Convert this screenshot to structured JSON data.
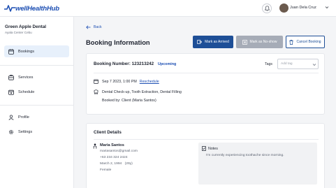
{
  "brand": {
    "logo_text": "wellHealthHub"
  },
  "header": {
    "user_name": "Juan Dela Cruz"
  },
  "sidebar": {
    "clinic_name": "Green Apple Dental",
    "clinic_location": "Ayala Center Cebu",
    "items": [
      {
        "label": "Bookings",
        "icon": "calendar-icon",
        "active": true
      },
      {
        "label": "Services",
        "icon": "services-icon",
        "active": false
      },
      {
        "label": "Schedule",
        "icon": "schedule-icon",
        "active": false
      },
      {
        "label": "Profile",
        "icon": "user-icon",
        "active": false
      },
      {
        "label": "Settings",
        "icon": "gear-icon",
        "active": false
      }
    ]
  },
  "page": {
    "back_label": "Back",
    "title": "Booking Information",
    "actions": {
      "mark_arrived": "Mark as Arrived",
      "mark_noshow": "Mark as No-show",
      "cancel": "Cancel Booking"
    }
  },
  "booking": {
    "number_label": "Booking Number: 123213242",
    "status": "Upcoming",
    "tags_label": "Tags",
    "tags_placeholder": "Add tag",
    "datetime": "Sep 7 2023, 1:00 PM",
    "reschedule_label": "Reschedule",
    "services": "Dental Check-up, Tooth Extraction, Dental Filling",
    "booked_by": "Booked by: Client (Maria Santos)"
  },
  "client": {
    "section_title": "Client Details",
    "name": "Maria Santos",
    "email": "mariasantos@gmail.com",
    "phone": "+63 234 324 2424",
    "birthdate": "March 2, 1994",
    "age": "(29y)",
    "gender": "Female",
    "notes_label": "Notes",
    "notes_text": "I'm currently experiencing toothache since morning."
  },
  "colors": {
    "primary": "#1e4f97",
    "link": "#1d4fb3",
    "disabled_button": "#a6acb7",
    "active_nav_bg": "#e7f0fb"
  }
}
